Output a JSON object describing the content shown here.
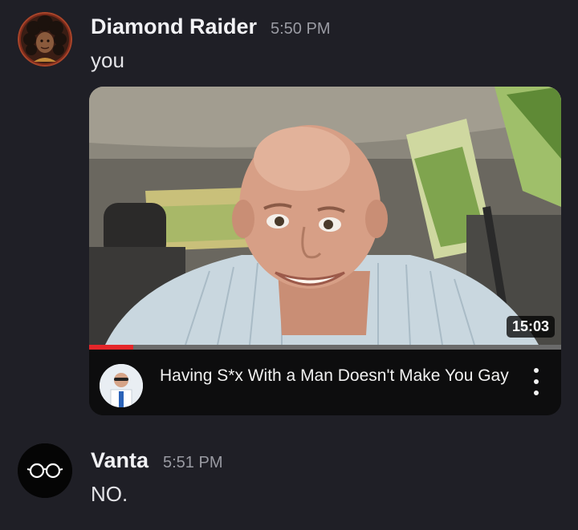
{
  "messages": [
    {
      "author": "Diamond Raider",
      "timestamp": "5:50 PM",
      "text": "you",
      "avatar_icon": "curly-hair-avatar",
      "embed": {
        "type": "youtube-video",
        "video_title": "Having S*x With a Man Doesn't Make You Gay",
        "duration": "15:03",
        "progress_fraction": 0.093,
        "menu_icon": "kebab-menu-icon",
        "channel_icon": "channel-avatar"
      }
    },
    {
      "author": "Vanta",
      "timestamp": "5:51 PM",
      "text": "NO.",
      "avatar_icon": "glasses-avatar"
    }
  ],
  "colors": {
    "background": "#1f1f26",
    "progress": "#e4262a",
    "timestamp": "#9a9ba3"
  }
}
